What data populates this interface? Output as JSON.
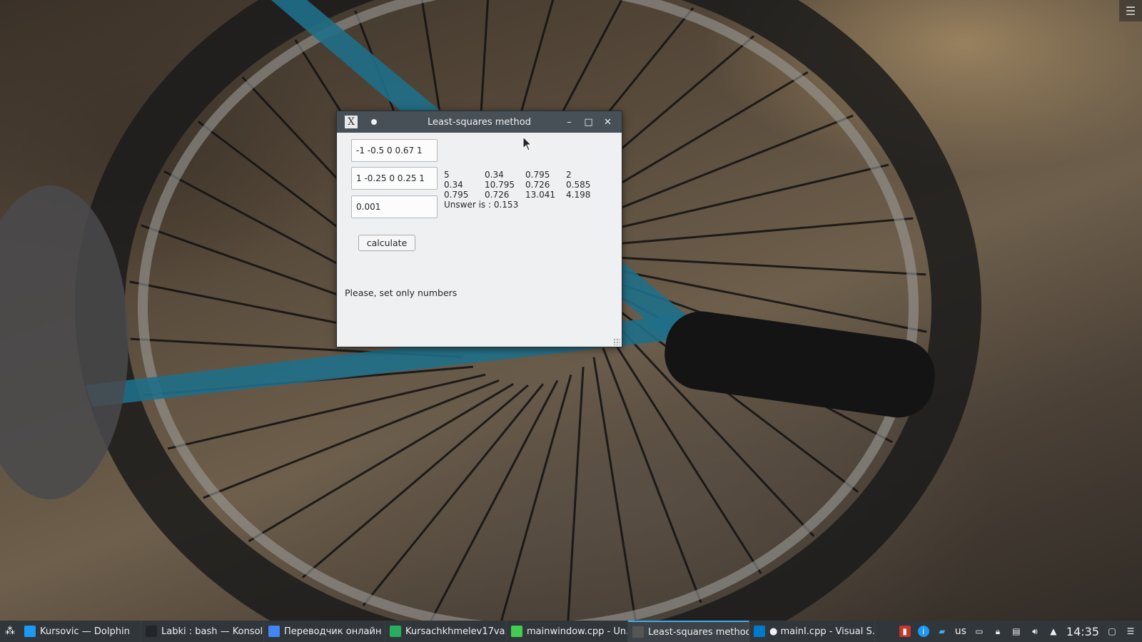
{
  "window": {
    "title": "Least-squares method",
    "inputs": {
      "x_values": "-1 -0.5 0 0.67 1",
      "y_values": "1 -0.25 0 0.25 1",
      "epsilon": "0.001"
    },
    "matrix": [
      [
        "5",
        "0.34",
        "0.795",
        "2"
      ],
      [
        "0.34",
        "10.795",
        "0.726",
        "0.585"
      ],
      [
        "0.795",
        "0.726",
        "13.041",
        "4.198"
      ]
    ],
    "answer": "Unswer is : 0.153",
    "calculate_label": "calculate",
    "message": "Please, set only numbers"
  },
  "taskbar": {
    "tasks": [
      {
        "label": "Kursovic — Dolphin",
        "color": "#1d99f3"
      },
      {
        "label": "Labki : bash — Konsole",
        "color": "#232629"
      },
      {
        "label": "Переводчик онлайн ...",
        "color": "#4285f4"
      },
      {
        "label": "Kursachkhmelev17va...",
        "color": "#27ae60"
      },
      {
        "label": "mainwindow.cpp - Un...",
        "color": "#41cd52"
      },
      {
        "label": "Least-squares method",
        "color": "#555555"
      },
      {
        "label": "● mainI.cpp - Visual S...",
        "color": "#007acc"
      }
    ],
    "keyboard_layout": "us",
    "clock": "14:35"
  },
  "colors": {
    "titlebar": "#475057",
    "window_bg": "#eff0f1",
    "taskbar": "#31363b",
    "active_task_accent": "#3daee9"
  }
}
